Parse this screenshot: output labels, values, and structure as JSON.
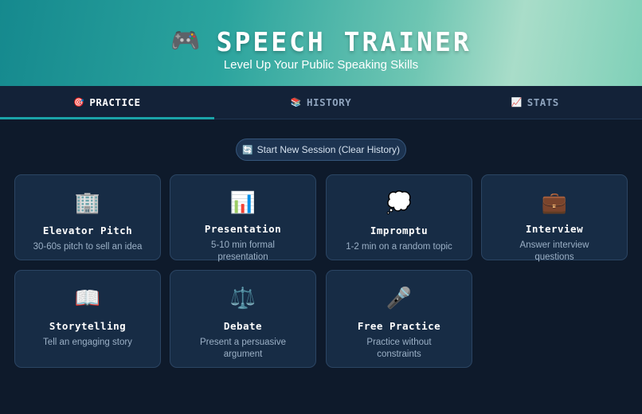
{
  "header": {
    "icon": "🎮",
    "title": "SPEECH TRAINER",
    "subtitle": "Level Up Your Public Speaking Skills"
  },
  "tabs": [
    {
      "icon": "🎯",
      "label": "PRACTICE",
      "active": true
    },
    {
      "icon": "📚",
      "label": "HISTORY",
      "active": false
    },
    {
      "icon": "📈",
      "label": "STATS",
      "active": false
    }
  ],
  "new_session": {
    "icon": "🔄",
    "label": "Start New Session (Clear History)"
  },
  "modes": [
    {
      "icon": "🏢",
      "name": "Elevator Pitch",
      "desc": "30-60s pitch to sell an idea"
    },
    {
      "icon": "📊",
      "name": "Presentation",
      "desc": "5-10 min formal presentation"
    },
    {
      "icon": "💭",
      "name": "Impromptu",
      "desc": "1-2 min on a random topic"
    },
    {
      "icon": "💼",
      "name": "Interview",
      "desc": "Answer interview questions"
    },
    {
      "icon": "📖",
      "name": "Storytelling",
      "desc": "Tell an engaging story"
    },
    {
      "icon": "⚖️",
      "name": "Debate",
      "desc": "Present a persuasive argument"
    },
    {
      "icon": "🎤",
      "name": "Free Practice",
      "desc": "Practice without constraints"
    }
  ],
  "colors": {
    "accent": "#1ba3a8",
    "background": "#0e1a2b",
    "card": "#172c45"
  }
}
